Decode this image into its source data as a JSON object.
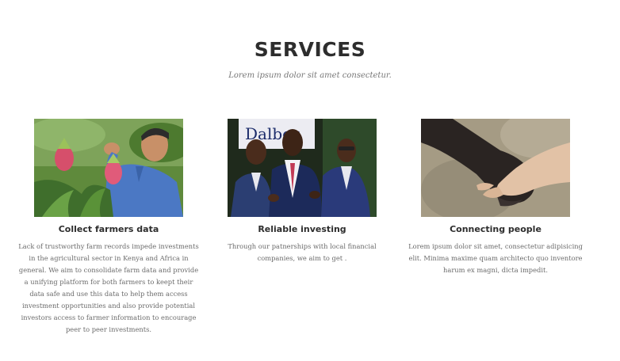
{
  "section": {
    "title": "SERVICES",
    "subtitle": "Lorem ipsum dolor sit amet consectetur."
  },
  "services": [
    {
      "title": "Collect farmers data",
      "text": "Lack of trustworthy farm records impede investments in the agricultural sector in Kenya and Africa in general. We aim to consolidate farm data and provide a unifying platform for both farmers to keept their data safe and use this data to help them access investment opportunities and also provide potential investors access to farmer information to encourage peer to peer investments.",
      "image": "farmer-photo"
    },
    {
      "title": "Reliable investing",
      "text": "Through our patnerships with local financial companies, we aim to get .",
      "image": "business-meeting-photo",
      "image_sign_text": "Dalber"
    },
    {
      "title": "Connecting people",
      "text": "Lorem ipsum dolor sit amet, consectetur adipisicing elit. Minima maxime quam architecto quo inventore harum ex magni, dicta impedit.",
      "image": "handshake-photo"
    }
  ]
}
